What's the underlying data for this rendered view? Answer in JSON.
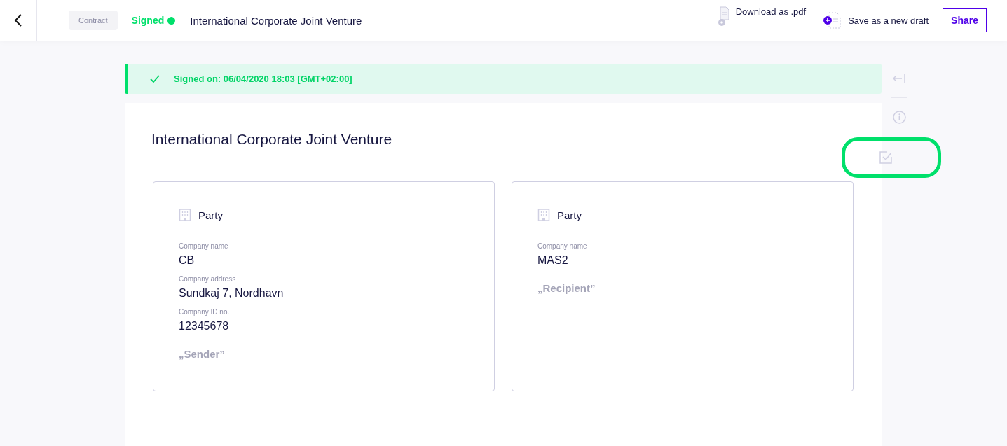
{
  "header": {
    "doc_type": "Contract",
    "status": "Signed",
    "title": "International Corporate Joint Venture",
    "actions": [
      {
        "kind": "download",
        "label": "Download as .pdf"
      },
      {
        "kind": "draft",
        "label": "Save as a new draft"
      }
    ],
    "share": "Share"
  },
  "banner": {
    "text": "Signed on: 06/04/2020 18:03 [GMT+02:00]"
  },
  "document": {
    "title": "International Corporate Joint Venture",
    "parties": [
      {
        "heading": "Party",
        "fields": [
          {
            "label": "Company name",
            "value": "CB"
          },
          {
            "label": "Company address",
            "value": "Sundkaj 7, Nordhavn"
          },
          {
            "label": "Company ID no.",
            "value": "12345678"
          }
        ],
        "role": "„Sender”"
      },
      {
        "heading": "Party",
        "fields": [
          {
            "label": "Company name",
            "value": "MAS2"
          }
        ],
        "role": "„Recipient”"
      }
    ]
  },
  "rail": [
    {
      "kind": "collapse",
      "highlighted": false
    },
    {
      "kind": "info",
      "highlighted": false
    },
    {
      "kind": "checklist",
      "highlighted": true
    }
  ]
}
